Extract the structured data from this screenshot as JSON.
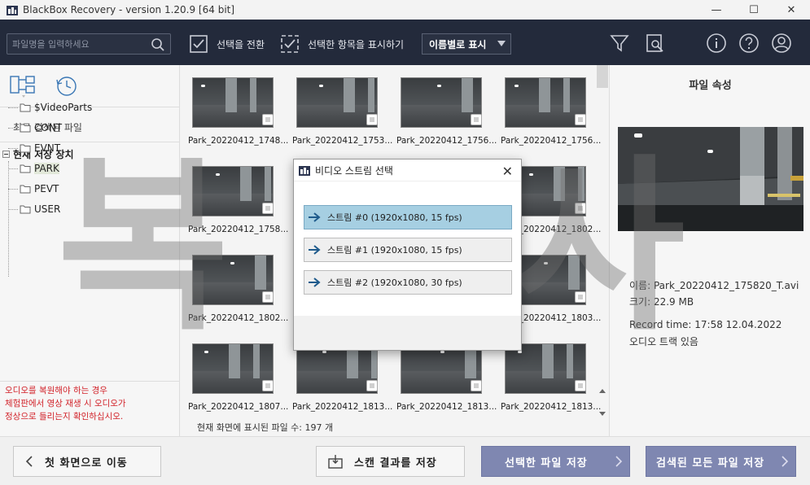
{
  "window": {
    "title": "BlackBox Recovery - version 1.20.9 [64 bit]",
    "minimize": "—",
    "maximize": "☐",
    "close": "✕"
  },
  "toolbar": {
    "search_placeholder": "파일명을 입력하세요",
    "toggle_selection_label": "선택을 전환",
    "show_selected_label": "선택한 항목을 표시하기",
    "view_select_value": "이름별로 표시"
  },
  "left_panel": {
    "recent_label": "최근 검색된 파일",
    "root_label": "현재 저장 장치",
    "folders": [
      "$VideoParts",
      "CONT",
      "EVNT",
      "PARK",
      "PEVT",
      "USER"
    ],
    "selected_folder": "PARK",
    "note_lines": [
      "오디오를 복원해야 하는 경우",
      "체험판에서 영상 재생 시 오디오가",
      "정상으로 들리는지 확인하십시오."
    ]
  },
  "thumbnails": [
    {
      "name": "Park_20220412_1748..."
    },
    {
      "name": "Park_20220412_1753..."
    },
    {
      "name": "Park_20220412_1756..."
    },
    {
      "name": "Park_20220412_1756..."
    },
    {
      "name": "Park_20220412_1758..."
    },
    {
      "name": ""
    },
    {
      "name": ""
    },
    {
      "name": "Park_20220412_1802..."
    },
    {
      "name": "Park_20220412_1802..."
    },
    {
      "name": ""
    },
    {
      "name": ""
    },
    {
      "name": "Park_20220412_1803..."
    },
    {
      "name": "Park_20220412_1807..."
    },
    {
      "name": "Park_20220412_1813..."
    },
    {
      "name": "Park_20220412_1813..."
    },
    {
      "name": "Park_20220412_1813..."
    }
  ],
  "status": {
    "files_shown_label": "현재 화면에 표시된 파일 수:",
    "files_shown_count": "197 개"
  },
  "properties": {
    "title": "파일 속성",
    "name_key": "이름:",
    "name_value": "Park_20220412_175820_T.avi",
    "size_key": "크기:",
    "size_value": "22.9 MB",
    "record_key": "Record time:",
    "record_value": "17:58 12.04.2022",
    "audio_note": "오디오 트랙 있음"
  },
  "bottom": {
    "home_label": "첫 화면으로 이동",
    "save_scan_label": "스캔 결과를 저장",
    "save_selected_label": "선택한 파일 저장",
    "save_all_label": "검색된 모든 파일 저장"
  },
  "watermark": {
    "left_char": "복",
    "right_char": "사"
  },
  "dialog": {
    "title": "비디오 스트림 선택",
    "close": "✕",
    "streams": [
      {
        "label": "스트림 #0 (1920x1080, 15 fps)",
        "selected": true
      },
      {
        "label": "스트림 #1 (1920x1080, 15 fps)",
        "selected": false
      },
      {
        "label": "스트림 #2 (1920x1080, 30 fps)",
        "selected": false
      }
    ]
  },
  "colors": {
    "toolbar_bg": "#232a3b",
    "primary_button": "#7f87b1",
    "selected_stream": "#a6cfe2",
    "note_red": "#d2232a"
  }
}
